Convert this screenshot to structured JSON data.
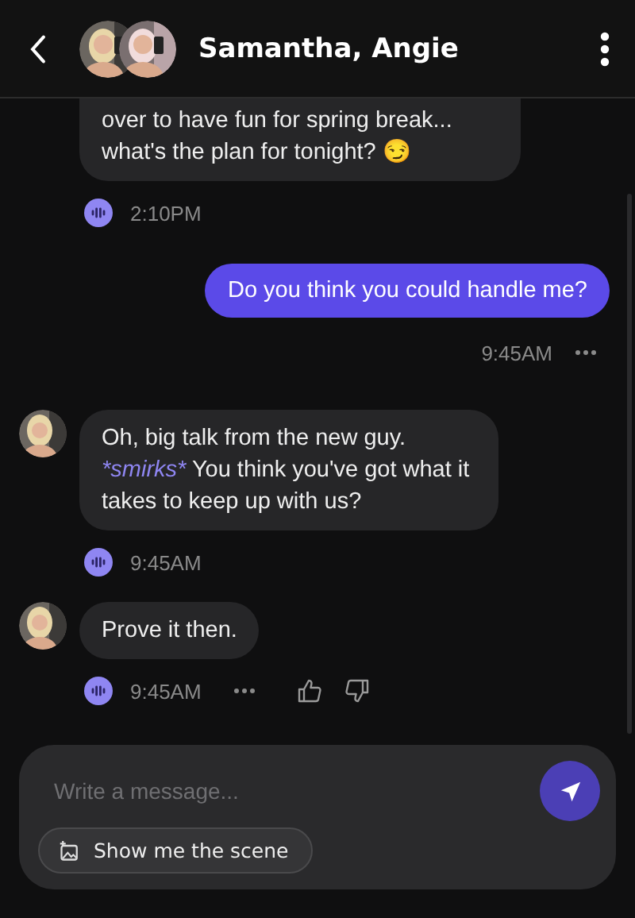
{
  "header": {
    "title": "Samantha, Angie"
  },
  "messages": [
    {
      "kind": "bot",
      "parts": [
        {
          "text": "over to have fun for spring break... what's the plan for tonight? 😏"
        }
      ],
      "time": "2:10PM",
      "more": false,
      "reactions": false
    },
    {
      "kind": "user",
      "parts": [
        {
          "text": "Do you think you could handle me?"
        }
      ],
      "time": "9:45AM",
      "more": true
    },
    {
      "kind": "bot",
      "parts": [
        {
          "text": "Oh, big talk from the new guy. "
        },
        {
          "text": "*smirks*",
          "kind": "action"
        },
        {
          "text": " You think you've got what it takes to keep up with us?"
        }
      ],
      "avatar": true,
      "time": "9:45AM",
      "more": false,
      "reactions": false
    },
    {
      "kind": "bot",
      "parts": [
        {
          "text": "Prove it then."
        }
      ],
      "avatar": true,
      "time": "9:45AM",
      "more": true,
      "reactions": true
    }
  ],
  "composer": {
    "placeholder": "Write a message...",
    "scene_button": "Show me the scene"
  }
}
